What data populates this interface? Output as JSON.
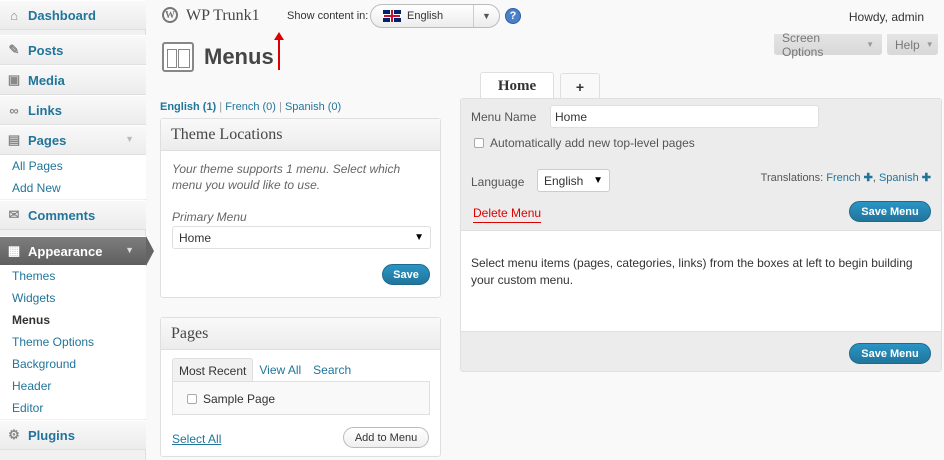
{
  "sidebar": {
    "items": [
      {
        "label": "Dashboard",
        "icon": "dashboard-icon"
      },
      {
        "label": "Posts",
        "icon": "pushpin-icon"
      },
      {
        "label": "Media",
        "icon": "media-icon"
      },
      {
        "label": "Links",
        "icon": "link-icon"
      },
      {
        "label": "Pages",
        "icon": "pages-icon"
      },
      {
        "label": "Comments",
        "icon": "comments-icon"
      },
      {
        "label": "Appearance",
        "icon": "appearance-icon"
      },
      {
        "label": "Plugins",
        "icon": "plugins-icon"
      }
    ],
    "pages_sub": [
      "All Pages",
      "Add New"
    ],
    "appearance_sub": [
      "Themes",
      "Widgets",
      "Menus",
      "Theme Options",
      "Background",
      "Header",
      "Editor"
    ]
  },
  "header": {
    "site_title": "WP Trunk1",
    "show_content_label": "Show content in:",
    "language": "English",
    "howdy": "Howdy, admin",
    "screen_options": "Screen Options",
    "help": "Help"
  },
  "page": {
    "title": "Menus",
    "lang_links": [
      "English (1)",
      "French (0)",
      "Spanish (0)"
    ]
  },
  "theme_locations": {
    "title": "Theme Locations",
    "note": "Your theme supports 1 menu. Select which menu you would like to use.",
    "primary_label": "Primary Menu",
    "primary_value": "Home",
    "save": "Save"
  },
  "pages_box": {
    "title": "Pages",
    "tabs": [
      "Most Recent",
      "View All",
      "Search"
    ],
    "items": [
      "Sample Page"
    ],
    "select_all": "Select All",
    "add_to_menu": "Add to Menu"
  },
  "menu_editor": {
    "tabs": [
      "Home",
      "+"
    ],
    "menu_name_label": "Menu Name",
    "menu_name_value": "Home",
    "auto_add_label": "Automatically add new top-level pages",
    "language_label": "Language",
    "language_value": "English",
    "translations_label": "Translations:",
    "translations": [
      "French",
      "Spanish"
    ],
    "delete_menu": "Delete Menu",
    "save_menu": "Save Menu",
    "instructions": "Select menu items (pages, categories, links) from the boxes at left to begin building your custom menu."
  },
  "colors": {
    "link": "#21759b",
    "primary_button": "#21759b",
    "delete": "#d00",
    "annotation_arrow": "#d00"
  }
}
